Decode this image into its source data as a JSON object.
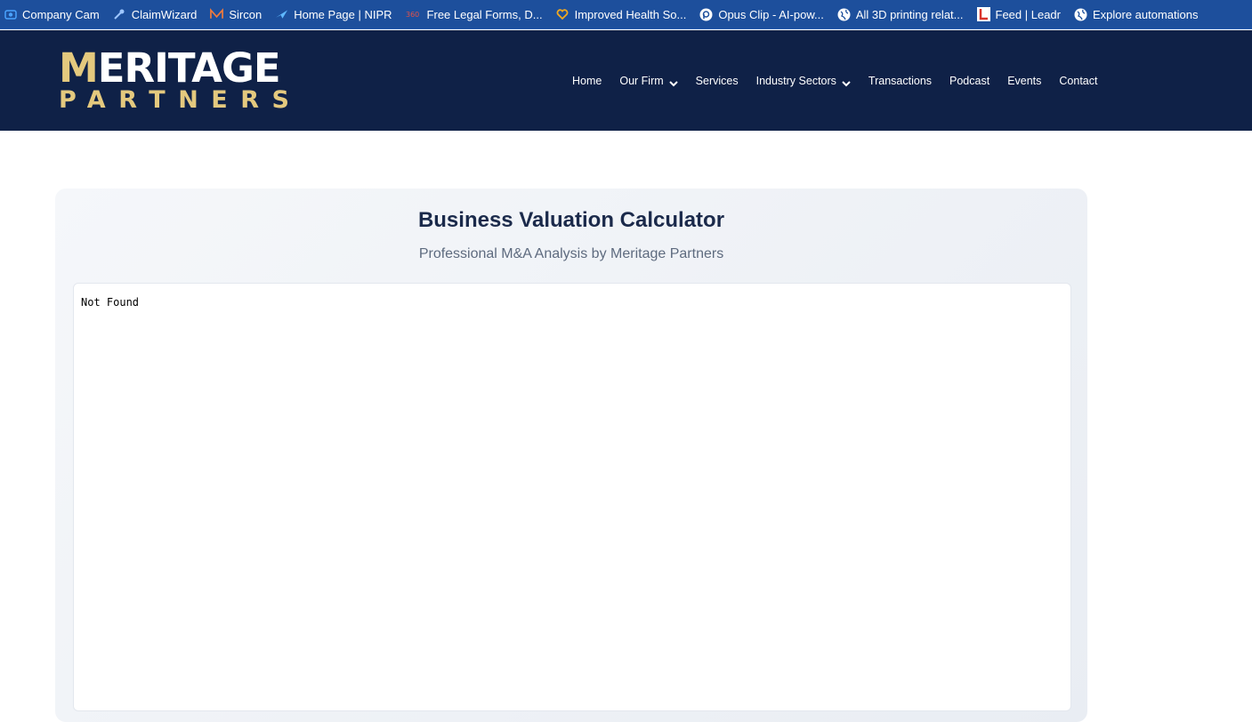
{
  "bookmarks": [
    {
      "label": "Company Cam",
      "icon": "camera-icon",
      "color": "#4aa3ff"
    },
    {
      "label": "ClaimWizard",
      "icon": "wand-icon",
      "color": "#9ec6ff"
    },
    {
      "label": "Sircon",
      "icon": "sircon-icon",
      "color": "#f07a3c"
    },
    {
      "label": "Home Page | NIPR",
      "icon": "plane-icon",
      "color": "#5fb8ff"
    },
    {
      "label": "Free Legal Forms, D...",
      "icon": "legal-icon",
      "color": "#e0524a"
    },
    {
      "label": "Improved Health So...",
      "icon": "heart-icon",
      "color": "#f2a91f"
    },
    {
      "label": "Opus Clip - AI-pow...",
      "icon": "opus-icon",
      "color": "#ffffff"
    },
    {
      "label": "All 3D printing relat...",
      "icon": "globe-icon",
      "color": "#ffffff"
    },
    {
      "label": "Feed | Leadr",
      "icon": "leadr-icon",
      "color": "#d9342b"
    },
    {
      "label": "Explore automations",
      "icon": "globe-icon",
      "color": "#ffffff"
    }
  ],
  "logo": {
    "line1": "ERITAGE",
    "mark": "M",
    "line2": "PARTNERS"
  },
  "nav": [
    {
      "label": "Home",
      "has_dropdown": false
    },
    {
      "label": "Our Firm",
      "has_dropdown": true
    },
    {
      "label": "Services",
      "has_dropdown": false
    },
    {
      "label": "Industry Sectors",
      "has_dropdown": true
    },
    {
      "label": "Transactions",
      "has_dropdown": false
    },
    {
      "label": "Podcast",
      "has_dropdown": false
    },
    {
      "label": "Events",
      "has_dropdown": false
    },
    {
      "label": "Contact",
      "has_dropdown": false
    }
  ],
  "calculator": {
    "title": "Business Valuation Calculator",
    "subtitle": "Professional M&A Analysis by Meritage Partners",
    "embed_message": "Not Found"
  },
  "colors": {
    "bookmarks_bg": "#1d4f9c",
    "header_bg": "#0f2147",
    "gold_accent": "#e4c97e",
    "title_color": "#1b2a4b"
  }
}
